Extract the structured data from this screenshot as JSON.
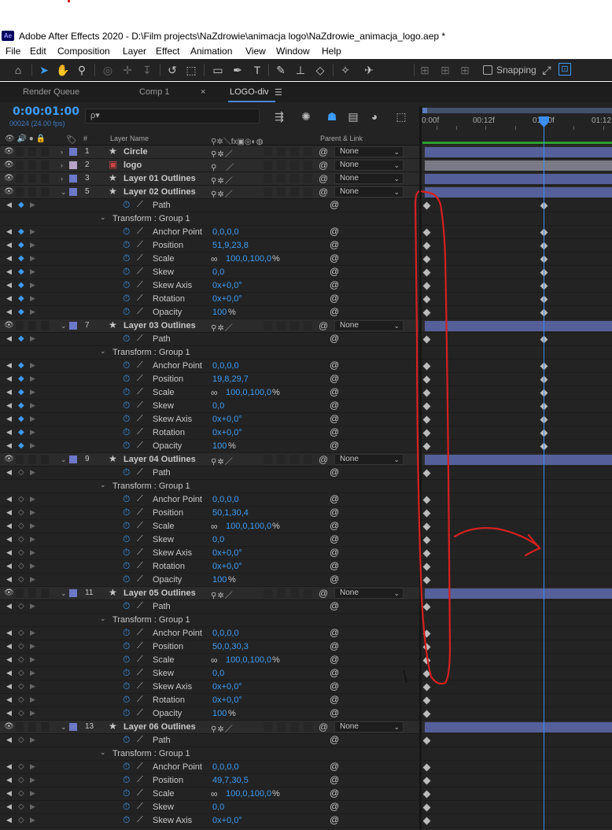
{
  "window": {
    "title": "Adobe After Effects 2020 - D:\\Film projects\\NaZdrowie\\animacja logo\\NaZdrowie_animacja_logo.aep *",
    "app_icon": "Ae"
  },
  "menu": [
    "File",
    "Edit",
    "Composition",
    "Layer",
    "Effect",
    "Animation",
    "View",
    "Window",
    "Help"
  ],
  "toolbar": {
    "snapping_label": "Snapping"
  },
  "tabs": [
    {
      "label": "Render Queue"
    },
    {
      "label": "Comp 1",
      "color": "#b89a7a"
    },
    {
      "label": "LOGO-div",
      "color": "#b89a7a",
      "active": true,
      "close": "×",
      "menu": "☰"
    }
  ],
  "comp": {
    "timecode": "0:00:01:00",
    "frames": "00024 (24.00 fps)",
    "search_placeholder": "ρ▾"
  },
  "columns": {
    "hash": "#",
    "layer_name": "Layer Name",
    "parent": "Parent & Link"
  },
  "ruler": {
    "labels": [
      "0:00f",
      "00:12f",
      "01:00f",
      "01:12"
    ],
    "playhead_frame": 24
  },
  "accent_color": "#3d9cf5",
  "layer_color": "#6d78c8",
  "track_bar_color": "#55609a",
  "annotation_color": "#d62020",
  "layers": [
    {
      "index": "1",
      "name": "Circle",
      "label_color": "#6d78c8",
      "parent": "None",
      "expanded": false
    },
    {
      "index": "2",
      "name": "logo",
      "label_color": "#b7a4c8",
      "parent": "None",
      "expanded": false,
      "footage": true
    },
    {
      "index": "3",
      "name": "Layer 01 Outlines",
      "label_color": "#6d78c8",
      "parent": "None",
      "expanded": false
    },
    {
      "index": "5",
      "name": "Layer 02 Outlines",
      "label_color": "#6d78c8",
      "parent": "None",
      "expanded": true,
      "path": "Path",
      "group": "Transform : Group 1",
      "props": [
        {
          "name": "Anchor Point",
          "value": "0,0,0,0"
        },
        {
          "name": "Position",
          "value": "51,9,23,8"
        },
        {
          "name": "Scale",
          "value": "100,0,100,0",
          "unit": "%"
        },
        {
          "name": "Skew",
          "value": "0,0"
        },
        {
          "name": "Skew Axis",
          "value": "0x+0,0°"
        },
        {
          "name": "Rotation",
          "value": "0x+0,0°"
        },
        {
          "name": "Opacity",
          "value": "100",
          "unit": "%"
        }
      ]
    },
    {
      "index": "7",
      "name": "Layer 03 Outlines",
      "label_color": "#6d78c8",
      "parent": "None",
      "expanded": true,
      "path": "Path",
      "group": "Transform : Group 1",
      "props": [
        {
          "name": "Anchor Point",
          "value": "0,0,0,0"
        },
        {
          "name": "Position",
          "value": "19,8,29,7"
        },
        {
          "name": "Scale",
          "value": "100,0,100,0",
          "unit": "%"
        },
        {
          "name": "Skew",
          "value": "0,0"
        },
        {
          "name": "Skew Axis",
          "value": "0x+0,0°"
        },
        {
          "name": "Rotation",
          "value": "0x+0,0°"
        },
        {
          "name": "Opacity",
          "value": "100",
          "unit": "%"
        }
      ]
    },
    {
      "index": "9",
      "name": "Layer 04 Outlines",
      "label_color": "#6d78c8",
      "parent": "None",
      "expanded": true,
      "path": "Path",
      "group": "Transform : Group 1",
      "props": [
        {
          "name": "Anchor Point",
          "value": "0,0,0,0"
        },
        {
          "name": "Position",
          "value": "50,1,30,4"
        },
        {
          "name": "Scale",
          "value": "100,0,100,0",
          "unit": "%"
        },
        {
          "name": "Skew",
          "value": "0,0"
        },
        {
          "name": "Skew Axis",
          "value": "0x+0,0°"
        },
        {
          "name": "Rotation",
          "value": "0x+0,0°"
        },
        {
          "name": "Opacity",
          "value": "100",
          "unit": "%"
        }
      ]
    },
    {
      "index": "11",
      "name": "Layer 05 Outlines",
      "label_color": "#6d78c8",
      "parent": "None",
      "expanded": true,
      "path": "Path",
      "group": "Transform : Group 1",
      "props": [
        {
          "name": "Anchor Point",
          "value": "0,0,0,0"
        },
        {
          "name": "Position",
          "value": "50,0,30,3"
        },
        {
          "name": "Scale",
          "value": "100,0,100,0",
          "unit": "%"
        },
        {
          "name": "Skew",
          "value": "0,0"
        },
        {
          "name": "Skew Axis",
          "value": "0x+0,0°"
        },
        {
          "name": "Rotation",
          "value": "0x+0,0°"
        },
        {
          "name": "Opacity",
          "value": "100",
          "unit": "%"
        }
      ]
    },
    {
      "index": "13",
      "name": "Layer 06 Outlines",
      "label_color": "#6d78c8",
      "parent": "None",
      "expanded": true,
      "path": "Path",
      "group": "Transform : Group 1",
      "props": [
        {
          "name": "Anchor Point",
          "value": "0,0,0,0"
        },
        {
          "name": "Position",
          "value": "49,7,30,5"
        },
        {
          "name": "Scale",
          "value": "100,0,100,0",
          "unit": "%"
        },
        {
          "name": "Skew",
          "value": "0,0"
        },
        {
          "name": "Skew Axis",
          "value": "0x+0,0°"
        }
      ]
    }
  ]
}
